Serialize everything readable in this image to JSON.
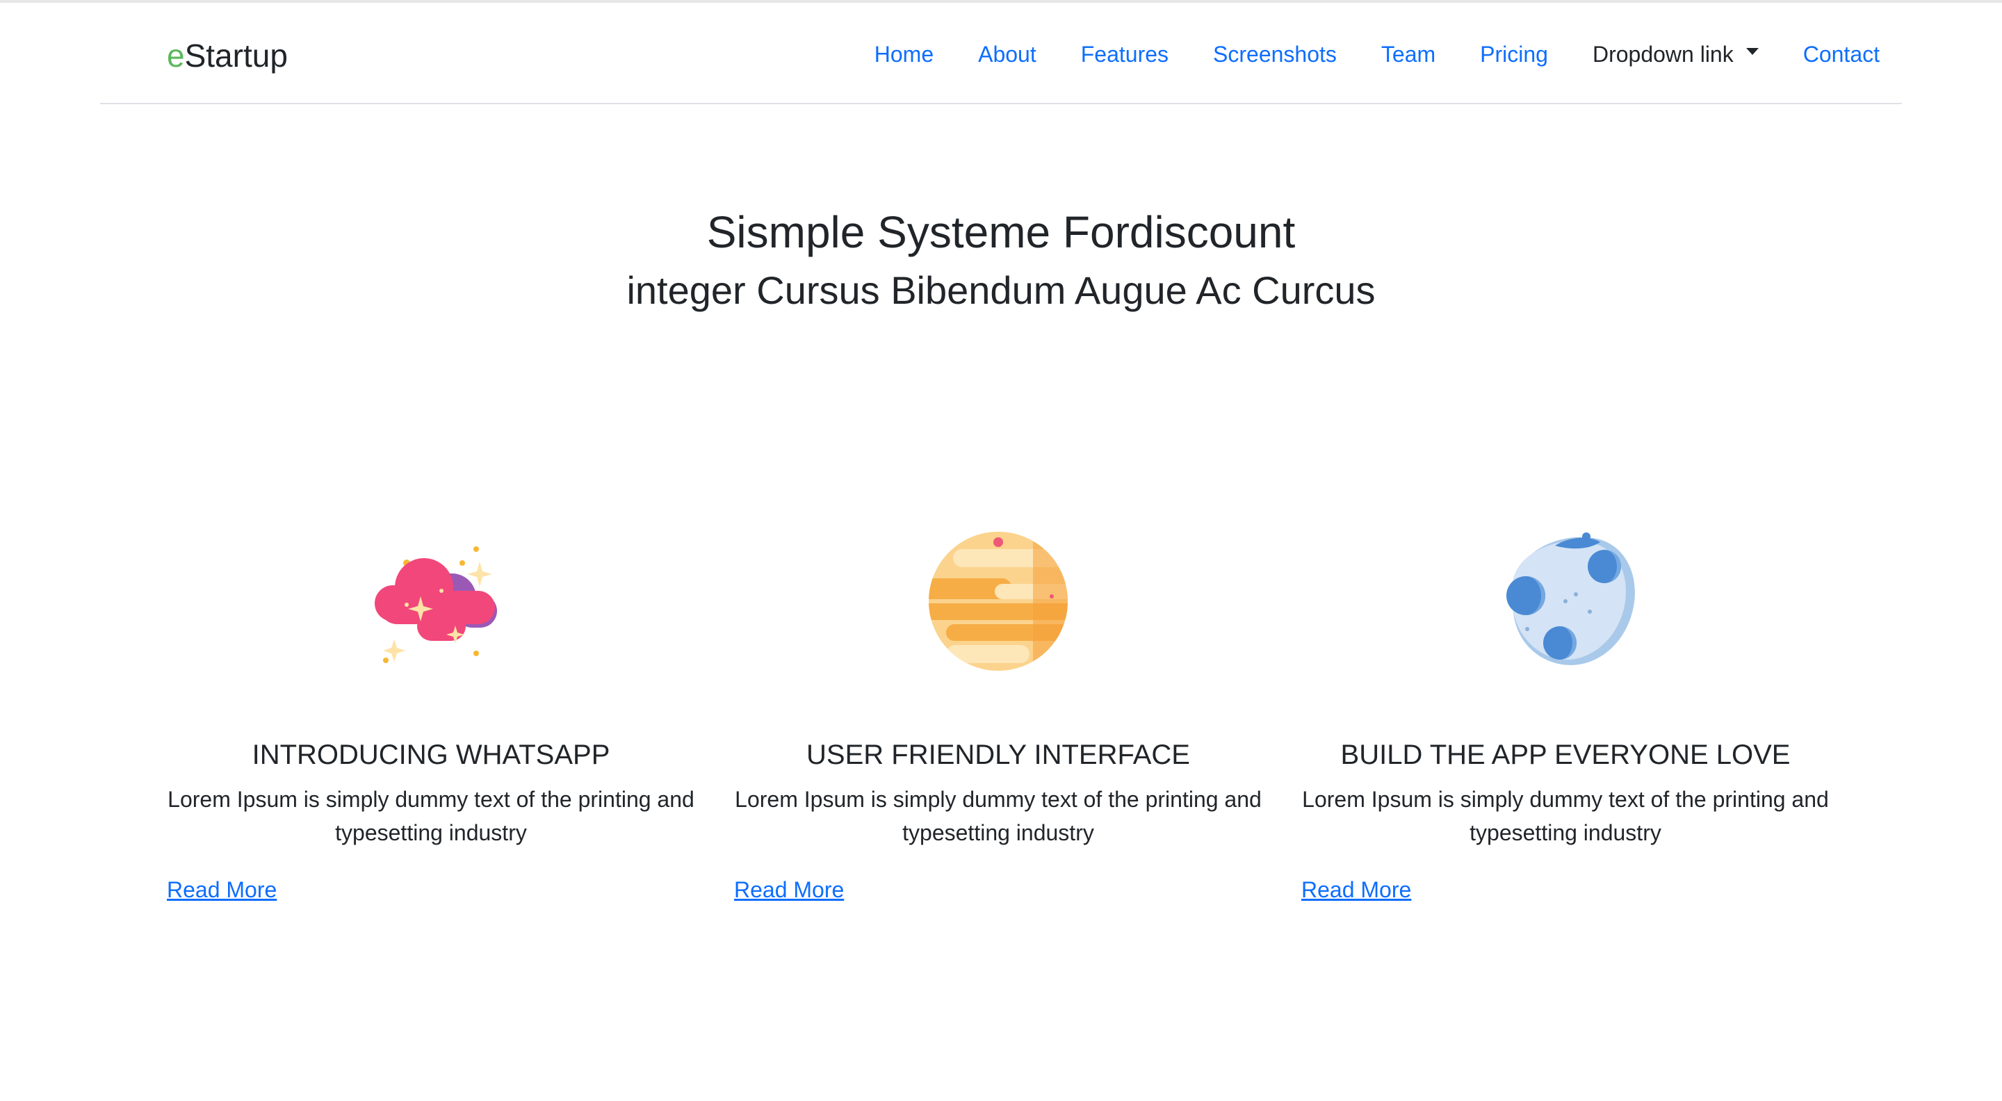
{
  "brand": {
    "accent_letter": "e",
    "rest": "Startup"
  },
  "nav": {
    "items": [
      {
        "label": "Home"
      },
      {
        "label": "About"
      },
      {
        "label": "Features"
      },
      {
        "label": "Screenshots"
      },
      {
        "label": "Team"
      },
      {
        "label": "Pricing"
      },
      {
        "label": "Dropdown link"
      },
      {
        "label": "Contact"
      }
    ]
  },
  "hero": {
    "title": "Sismple Systeme Fordiscount",
    "subtitle": "integer Cursus Bibendum Augue Ac Curcus"
  },
  "features": [
    {
      "icon": "cloud-icon",
      "title": "INTRODUCING WHATSAPP",
      "text": "Lorem Ipsum is simply dummy text of the printing and typesetting industry",
      "link": "Read More "
    },
    {
      "icon": "planet-icon",
      "title": "USER FRIENDLY INTERFACE",
      "text": "Lorem Ipsum is simply dummy text of the printing and typesetting industry",
      "link": "Read More "
    },
    {
      "icon": "moon-icon",
      "title": "BUILD THE APP EVERYONE LOVE",
      "text": "Lorem Ipsum is simply dummy text of the printing and typesetting industry",
      "link": "Read More "
    }
  ],
  "colors": {
    "link": "#0d6efd",
    "brand_accent": "#5cb85c",
    "text": "#212529"
  }
}
